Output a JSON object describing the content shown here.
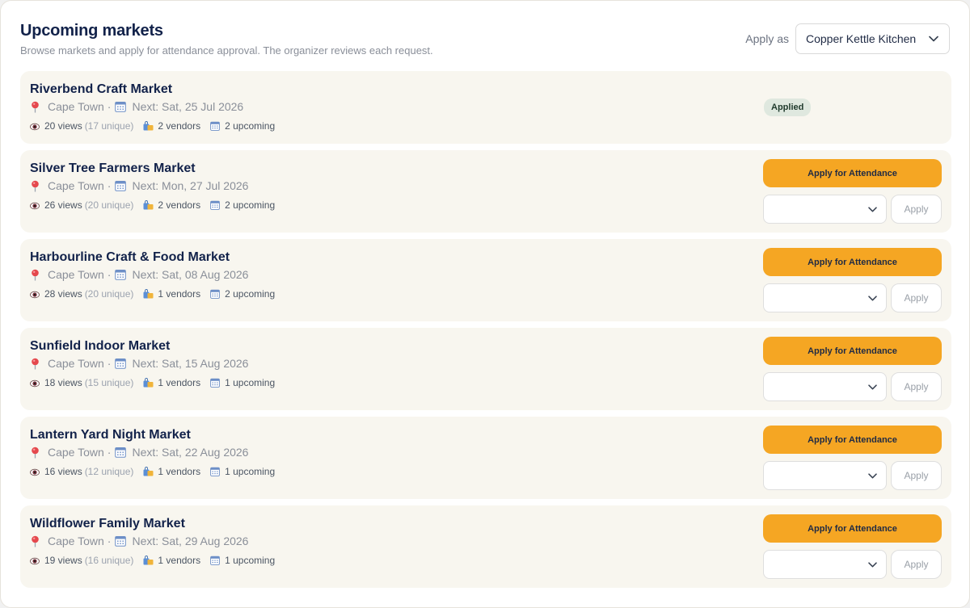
{
  "header": {
    "title": "Upcoming markets",
    "subtitle": "Browse markets and apply for attendance approval. The organizer reviews each request."
  },
  "apply_as": {
    "label": "Apply as",
    "selected": "Copper Kettle Kitchen"
  },
  "labels": {
    "separator": "·",
    "views_suffix": "views",
    "vendors_suffix": "vendors",
    "upcoming_suffix": "upcoming",
    "apply_attendance": "Apply for Attendance",
    "apply": "Apply",
    "applied": "Applied"
  },
  "colors": {
    "accent": "#f5a623",
    "card_bg": "#f8f6ef",
    "title": "#12224a",
    "applied_badge": "#dfe8df"
  },
  "markets": [
    {
      "name": "Riverbend Craft Market",
      "location": "Cape Town",
      "next": "Next: Sat, 25 Jul 2026",
      "views": "20 views",
      "unique": "(17 unique)",
      "vendors": "2 vendors",
      "upcoming": "2 upcoming",
      "status": "applied"
    },
    {
      "name": "Silver Tree Farmers Market",
      "location": "Cape Town",
      "next": "Next: Mon, 27 Jul 2026",
      "views": "26 views",
      "unique": "(20 unique)",
      "vendors": "2 vendors",
      "upcoming": "2 upcoming",
      "status": "open"
    },
    {
      "name": "Harbourline Craft & Food Market",
      "location": "Cape Town",
      "next": "Next: Sat, 08 Aug 2026",
      "views": "28 views",
      "unique": "(20 unique)",
      "vendors": "1 vendors",
      "upcoming": "2 upcoming",
      "status": "open"
    },
    {
      "name": "Sunfield Indoor Market",
      "location": "Cape Town",
      "next": "Next: Sat, 15 Aug 2026",
      "views": "18 views",
      "unique": "(15 unique)",
      "vendors": "1 vendors",
      "upcoming": "1 upcoming",
      "status": "open"
    },
    {
      "name": "Lantern Yard Night Market",
      "location": "Cape Town",
      "next": "Next: Sat, 22 Aug 2026",
      "views": "16 views",
      "unique": "(12 unique)",
      "vendors": "1 vendors",
      "upcoming": "1 upcoming",
      "status": "open"
    },
    {
      "name": "Wildflower Family Market",
      "location": "Cape Town",
      "next": "Next: Sat, 29 Aug 2026",
      "views": "19 views",
      "unique": "(16 unique)",
      "vendors": "1 vendors",
      "upcoming": "1 upcoming",
      "status": "open"
    }
  ]
}
